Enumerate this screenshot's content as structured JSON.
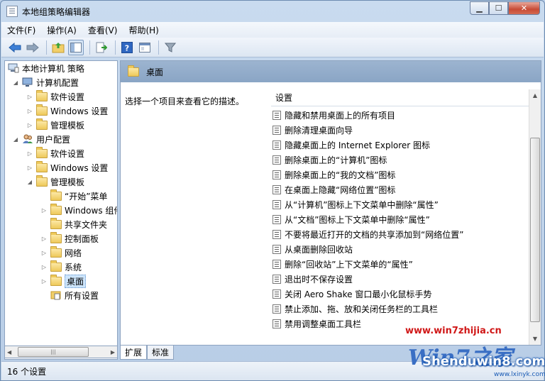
{
  "window": {
    "title": "本地组策略编辑器",
    "caption": {
      "minimize": "▁",
      "maximize": "☐",
      "close": "✕"
    }
  },
  "menu": [
    "文件(F)",
    "操作(A)",
    "查看(V)",
    "帮助(H)"
  ],
  "toolbar": {
    "icons": [
      "back-arrow-icon",
      "forward-arrow-icon",
      "up-folder-icon",
      "show-hide-tree-icon",
      "export-list-icon",
      "help-icon",
      "properties-icon",
      "filter-icon"
    ]
  },
  "tree": {
    "root": "本地计算机 策略",
    "computer_config": "计算机配置",
    "cc_software": "软件设置",
    "cc_windows": "Windows 设置",
    "cc_admin": "管理模板",
    "user_config": "用户配置",
    "uc_software": "软件设置",
    "uc_windows": "Windows 设置",
    "uc_admin": "管理模板",
    "start_menu": "“开始”菜单",
    "windows_components": "Windows 组件",
    "shared_folders": "共享文件夹",
    "control_panel": "控制面板",
    "network": "网络",
    "system": "系统",
    "desktop": "桌面",
    "all_settings": "所有设置"
  },
  "content": {
    "header_title": "桌面",
    "description": "选择一个项目来查看它的描述。",
    "column_header": "设置",
    "settings": [
      "隐藏和禁用桌面上的所有项目",
      "删除清理桌面向导",
      "隐藏桌面上的 Internet Explorer 图标",
      "删除桌面上的“计算机”图标",
      "删除桌面上的“我的文档”图标",
      "在桌面上隐藏“网络位置”图标",
      "从“计算机”图标上下文菜单中删除“属性”",
      "从“文档”图标上下文菜单中删除“属性”",
      "不要将最近打开的文档的共享添加到“网络位置”",
      "从桌面删除回收站",
      "删除“回收站”上下文菜单的“属性”",
      "退出时不保存设置",
      "关闭 Aero Shake 窗口最小化鼠标手势",
      "禁止添加、拖、放和关闭任务栏的工具栏",
      "禁用调整桌面工具栏"
    ]
  },
  "tabs": [
    "扩展",
    "标准"
  ],
  "status": "16 个设置",
  "watermark": {
    "url1": "www.win7zhijia.cn",
    "logo": "Win7之家",
    "url2": "Shenduwin8.com",
    "url3": "www.lxinyk.com"
  }
}
